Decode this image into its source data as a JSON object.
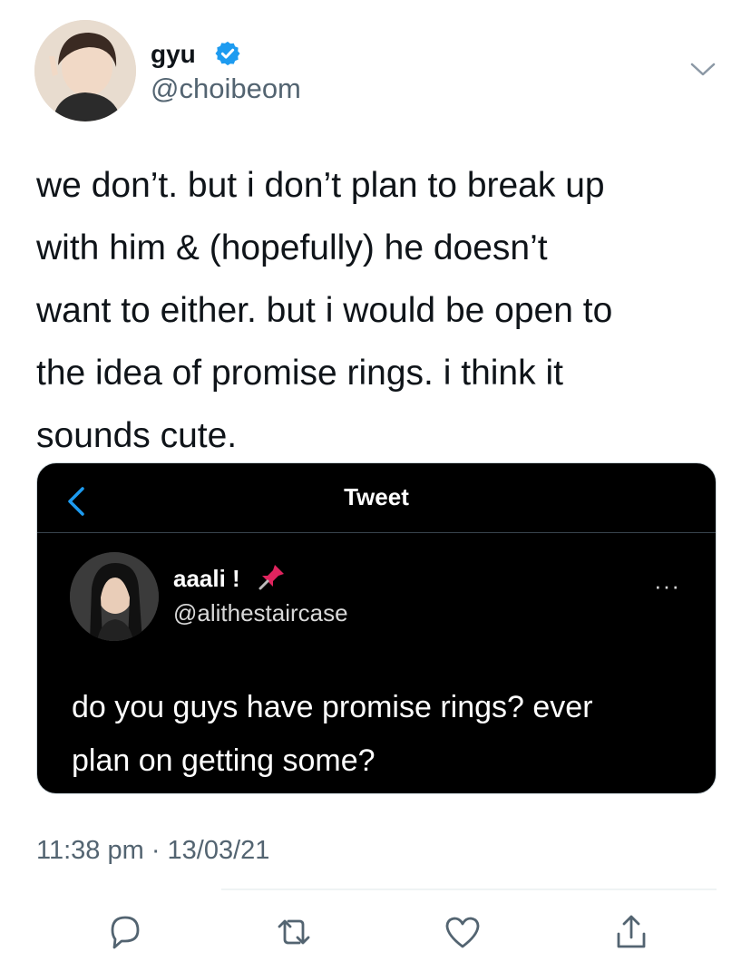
{
  "author": {
    "name": "gyu",
    "handle": "@choibeom",
    "verified_color": "#1d9bf0",
    "avatar_icon": "user-avatar"
  },
  "tweet": {
    "lines": [
      "we don’t. but i don’t plan to break up",
      "with him & (hopefully) he doesn’t",
      "want to either. but i would be open to",
      "the idea of promise rings. i think it",
      "sounds cute."
    ],
    "timestamp": "11:38 pm · 13/03/21"
  },
  "embedded_screenshot": {
    "header_title": "Tweet",
    "back_icon": "chevron-left-icon",
    "author_name": "aaali !",
    "author_handle": "@alithestaircase",
    "pin_icon": "pushpin-icon",
    "more_label": "···",
    "lines": [
      "do you guys have promise rings? ever",
      "plan on getting some?"
    ],
    "background_color": "#000000"
  },
  "actions": [
    {
      "name": "reply",
      "icon": "reply-icon"
    },
    {
      "name": "retweet",
      "icon": "retweet-icon"
    },
    {
      "name": "like",
      "icon": "heart-icon"
    },
    {
      "name": "share",
      "icon": "share-icon"
    }
  ],
  "colors": {
    "text_primary": "#0f1419",
    "text_secondary": "#536471",
    "accent": "#1d9bf0"
  }
}
